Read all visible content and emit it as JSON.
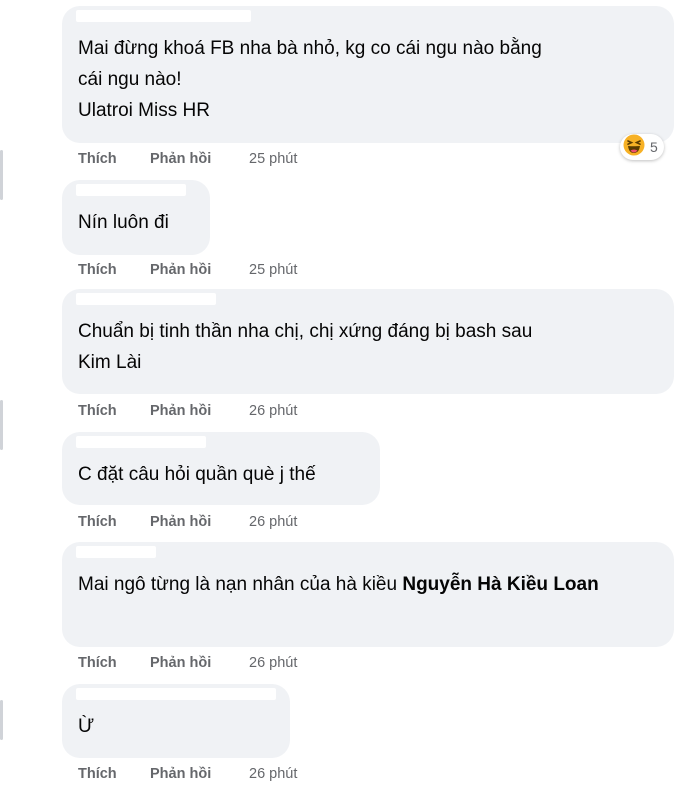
{
  "actions": {
    "like_label": "Thích",
    "reply_label": "Phản hồi"
  },
  "comments": [
    {
      "text": "Mai đừng khoá FB nha bà nhỏ, kg co cái ngu nào bằng cái ngu nào! Ulatroi Miss HR",
      "lines": [
        "Mai đừng khoá FB nha bà nhỏ, kg co cái ngu nào bằng",
        "cái ngu nào!",
        "Ulatroi Miss HR"
      ],
      "time": "25 phút",
      "reaction": {
        "icon": "haha-icon",
        "count": "5"
      }
    },
    {
      "text": "Nín luôn đi",
      "time": "25 phút"
    },
    {
      "text": "Chuẩn bị tinh thần nha chị, chị xứng đáng bị bash sau Kim Lài",
      "lines": [
        "Chuẩn bị tinh thần nha chị, chị xứng đáng bị bash sau",
        "Kim Lài"
      ],
      "time": "26 phút"
    },
    {
      "text": "C đặt câu hỏi quần què j thế",
      "time": "26 phút"
    },
    {
      "text": "Mai ngô từng là nạn nhân của hà kiều",
      "mention": "Nguyễn Hà Kiều Loan",
      "time": "26 phút"
    },
    {
      "text": "Ừ",
      "time": "26 phút"
    }
  ]
}
